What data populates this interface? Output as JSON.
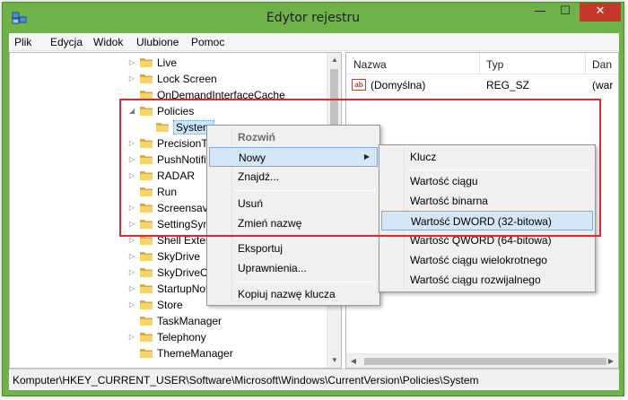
{
  "window": {
    "title": "Edytor rejestru",
    "minimize_glyph": "—",
    "maximize_glyph": "☐",
    "close_glyph": "✕",
    "accent_color": "#6fb24a"
  },
  "menubar": [
    "Plik",
    "Edycja",
    "Widok",
    "Ulubione",
    "Pomoc"
  ],
  "tree": {
    "items": [
      {
        "label": "Live",
        "expander": "▷"
      },
      {
        "label": "Lock Screen",
        "expander": "▷"
      },
      {
        "label": "OnDemandInterfaceCache",
        "expander": ""
      },
      {
        "label": "Policies",
        "expander": "◢"
      },
      {
        "label": "System",
        "expander": ""
      },
      {
        "label": "PrecisionTo",
        "expander": "▷"
      },
      {
        "label": "PushNotific",
        "expander": "▷"
      },
      {
        "label": "RADAR",
        "expander": "▷"
      },
      {
        "label": "Run",
        "expander": ""
      },
      {
        "label": "Screensave",
        "expander": "▷"
      },
      {
        "label": "SettingSync",
        "expander": "▷"
      },
      {
        "label": "Shell Extens",
        "expander": "▷"
      },
      {
        "label": "SkyDrive",
        "expander": "▷"
      },
      {
        "label": "SkyDriveOp",
        "expander": "▷"
      },
      {
        "label": "StartupNot",
        "expander": "▷"
      },
      {
        "label": "Store",
        "expander": "▷"
      },
      {
        "label": "TaskManager",
        "expander": ""
      },
      {
        "label": "Telephony",
        "expander": "▷"
      },
      {
        "label": "ThemeManager",
        "expander": ""
      }
    ],
    "scroll_up": "▲",
    "scroll_down": "▼"
  },
  "list": {
    "columns": [
      "Nazwa",
      "Typ",
      "Dan"
    ],
    "rows": [
      {
        "icon": "ab",
        "name": "(Domyślna)",
        "type": "REG_SZ",
        "data": "(war"
      }
    ],
    "scroll_left": "◀",
    "scroll_right": "▶"
  },
  "context_menu": {
    "items": [
      {
        "label": "Rozwiń"
      },
      {
        "label": "Nowy",
        "submenu_arrow": "▶"
      },
      {
        "label": "Znajdź..."
      },
      {
        "label": "Usuń"
      },
      {
        "label": "Zmień nazwę"
      },
      {
        "label": "Eksportuj"
      },
      {
        "label": "Uprawnienia..."
      },
      {
        "label": "Kopiuj nazwę klucza"
      }
    ]
  },
  "submenu": {
    "items": [
      {
        "label": "Klucz"
      },
      {
        "label": "Wartość ciągu"
      },
      {
        "label": "Wartość binarna"
      },
      {
        "label": "Wartość DWORD (32-bitowa)"
      },
      {
        "label": "Wartość QWORD (64-bitowa)"
      },
      {
        "label": "Wartość ciągu wielokrotnego"
      },
      {
        "label": "Wartość ciągu rozwijalnego"
      }
    ]
  },
  "status": {
    "path": "Komputer\\HKEY_CURRENT_USER\\Software\\Microsoft\\Windows\\CurrentVersion\\Policies\\System"
  },
  "annotation_color": "#e0272d"
}
